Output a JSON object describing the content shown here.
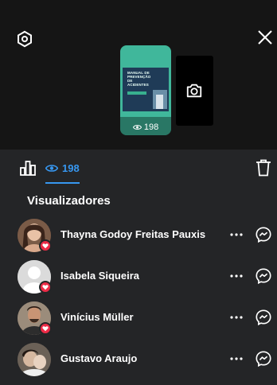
{
  "story": {
    "thumbnail_title": "MANUAL DE PREVENÇÃO DE ACIDENTES",
    "view_count": "198"
  },
  "tabs": {
    "views_count": "198"
  },
  "viewers_title": "Visualizadores",
  "viewers": [
    {
      "name": "Thayna Godoy Freitas Pauxis",
      "liked": true,
      "avatar_color": "#6b4a3a"
    },
    {
      "name": "Isabela Siqueira",
      "liked": true,
      "avatar_color": "#d8d8d8"
    },
    {
      "name": "Vinícius Müller",
      "liked": true,
      "avatar_color": "#8a7a6a"
    },
    {
      "name": "Gustavo Araujo",
      "liked": false,
      "avatar_color": "#5a5047"
    }
  ],
  "colors": {
    "accent": "#3797f0",
    "heart": "#ed2b47",
    "story_bg": "#40b79b"
  }
}
